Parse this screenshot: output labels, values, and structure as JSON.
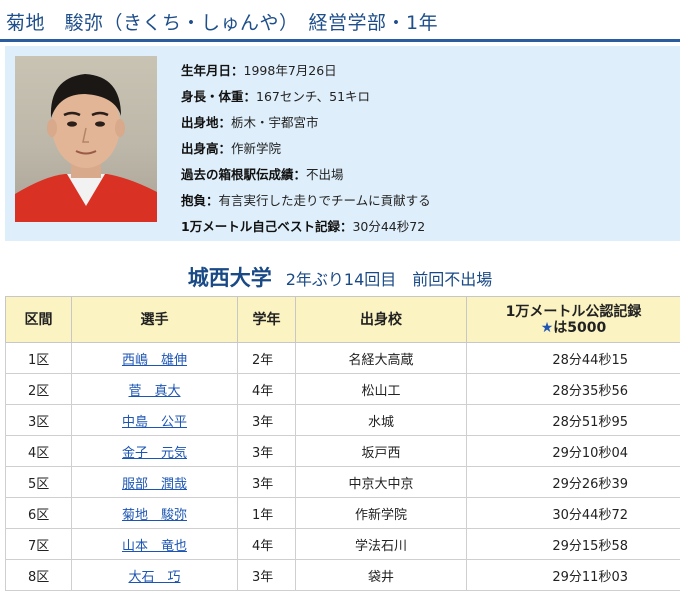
{
  "header": {
    "title": "菊地　駿弥（きくち・しゅんや）　経営学部・1年"
  },
  "profile": {
    "fields": [
      {
        "label": "生年月日：",
        "value": "1998年7月26日"
      },
      {
        "label": "身長・体重：",
        "value": "167センチ、51キロ"
      },
      {
        "label": "出身地：",
        "value": "栃木・宇都宮市"
      },
      {
        "label": "出身高：",
        "value": "作新学院"
      },
      {
        "label": "過去の箱根駅伝成績：",
        "value": "不出場"
      },
      {
        "label": "抱負：",
        "value": "有言実行した走りでチームに貢献する"
      },
      {
        "label": "1万メートル自己ベスト記録：",
        "value": "30分44秒72"
      }
    ]
  },
  "team": {
    "name": "城西大学",
    "note": "2年ぶり14回目　前回不出場"
  },
  "roster": {
    "headers": {
      "leg": "区間",
      "runner": "選手",
      "year": "学年",
      "school": "出身校",
      "record_line1": "1万メートル公認記録",
      "record_star": "★",
      "record_line2": "は5000"
    },
    "rows": [
      {
        "leg": "1区",
        "name": "西嶋　雄伸",
        "year": "2年",
        "school": "名経大高蔵",
        "record": "28分44秒15"
      },
      {
        "leg": "2区",
        "name": "菅　真大",
        "year": "4年",
        "school": "松山工",
        "record": "28分35秒56"
      },
      {
        "leg": "3区",
        "name": "中島　公平",
        "year": "3年",
        "school": "水城",
        "record": "28分51秒95"
      },
      {
        "leg": "4区",
        "name": "金子　元気",
        "year": "3年",
        "school": "坂戸西",
        "record": "29分10秒04"
      },
      {
        "leg": "5区",
        "name": "服部　潤哉",
        "year": "3年",
        "school": "中京大中京",
        "record": "29分26秒39"
      },
      {
        "leg": "6区",
        "name": "菊地　駿弥",
        "year": "1年",
        "school": "作新学院",
        "record": "30分44秒72"
      },
      {
        "leg": "7区",
        "name": "山本　竜也",
        "year": "4年",
        "school": "学法石川",
        "record": "29分15秒58"
      },
      {
        "leg": "8区",
        "name": "大石　巧",
        "year": "3年",
        "school": "袋井",
        "record": "29分11秒03"
      }
    ]
  },
  "colors": {
    "title_blue": "#1f4f8a",
    "header_rule": "#2a5d9f",
    "profile_bg": "#deeefa",
    "table_header_bg": "#fbf3c2",
    "link_blue": "#1c55b3"
  }
}
